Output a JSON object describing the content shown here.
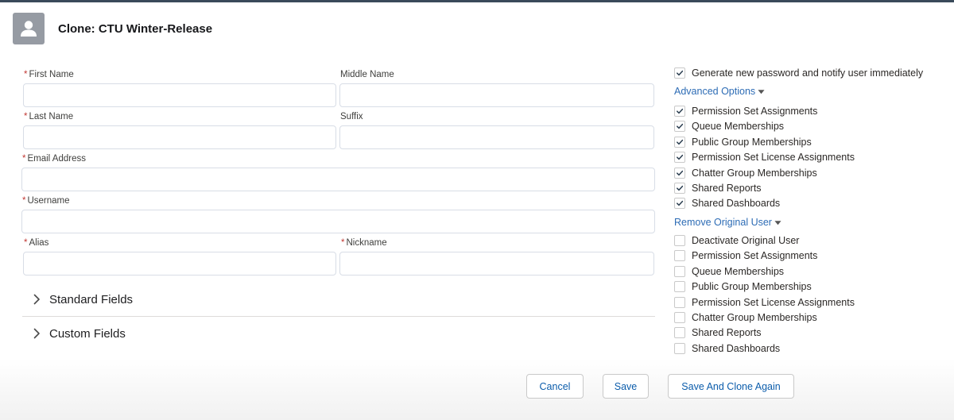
{
  "header": {
    "title": "Clone: CTU Winter-Release",
    "avatar_icon": "user-icon"
  },
  "form": {
    "first_name": {
      "label": "First Name",
      "required": "*",
      "value": ""
    },
    "middle_name": {
      "label": "Middle Name",
      "value": ""
    },
    "last_name": {
      "label": "Last Name",
      "required": "*",
      "value": ""
    },
    "suffix": {
      "label": "Suffix",
      "value": ""
    },
    "email": {
      "label": "Email Address",
      "required": "*",
      "value": ""
    },
    "username": {
      "label": "Username",
      "required": "*",
      "value": ""
    },
    "alias": {
      "label": "Alias",
      "required": "*",
      "value": ""
    },
    "nickname": {
      "label": "Nickname",
      "required": "*",
      "value": ""
    }
  },
  "sections": {
    "standard": {
      "label": "Standard Fields",
      "icon": "chevron-right-icon"
    },
    "custom": {
      "label": "Custom Fields",
      "icon": "chevron-right-icon"
    }
  },
  "options": {
    "generate_password": {
      "label": "Generate new password and notify user immediately",
      "checked": true
    },
    "advanced_toggle": {
      "label": "Advanced Options",
      "icon": "caret-down-icon"
    },
    "advanced": [
      {
        "label": "Permission Set Assignments",
        "checked": true
      },
      {
        "label": "Queue Memberships",
        "checked": true
      },
      {
        "label": "Public Group Memberships",
        "checked": true
      },
      {
        "label": "Permission Set License Assignments",
        "checked": true
      },
      {
        "label": "Chatter Group Memberships",
        "checked": true
      },
      {
        "label": "Shared Reports",
        "checked": true
      },
      {
        "label": "Shared Dashboards",
        "checked": true
      }
    ],
    "remove_toggle": {
      "label": "Remove Original User",
      "icon": "caret-down-icon"
    },
    "remove": [
      {
        "label": "Deactivate Original User",
        "checked": false
      },
      {
        "label": "Permission Set Assignments",
        "checked": false
      },
      {
        "label": "Queue Memberships",
        "checked": false
      },
      {
        "label": "Public Group Memberships",
        "checked": false
      },
      {
        "label": "Permission Set License Assignments",
        "checked": false
      },
      {
        "label": "Chatter Group Memberships",
        "checked": false
      },
      {
        "label": "Shared Reports",
        "checked": false
      },
      {
        "label": "Shared Dashboards",
        "checked": false
      }
    ]
  },
  "footer": {
    "cancel_label": "Cancel",
    "save_label": "Save",
    "save_clone_label": "Save And Clone Again"
  },
  "colors": {
    "link": "#2d6cb5",
    "required": "#c23934",
    "button_text": "#0b5cab",
    "avatar": "#969ba3"
  }
}
